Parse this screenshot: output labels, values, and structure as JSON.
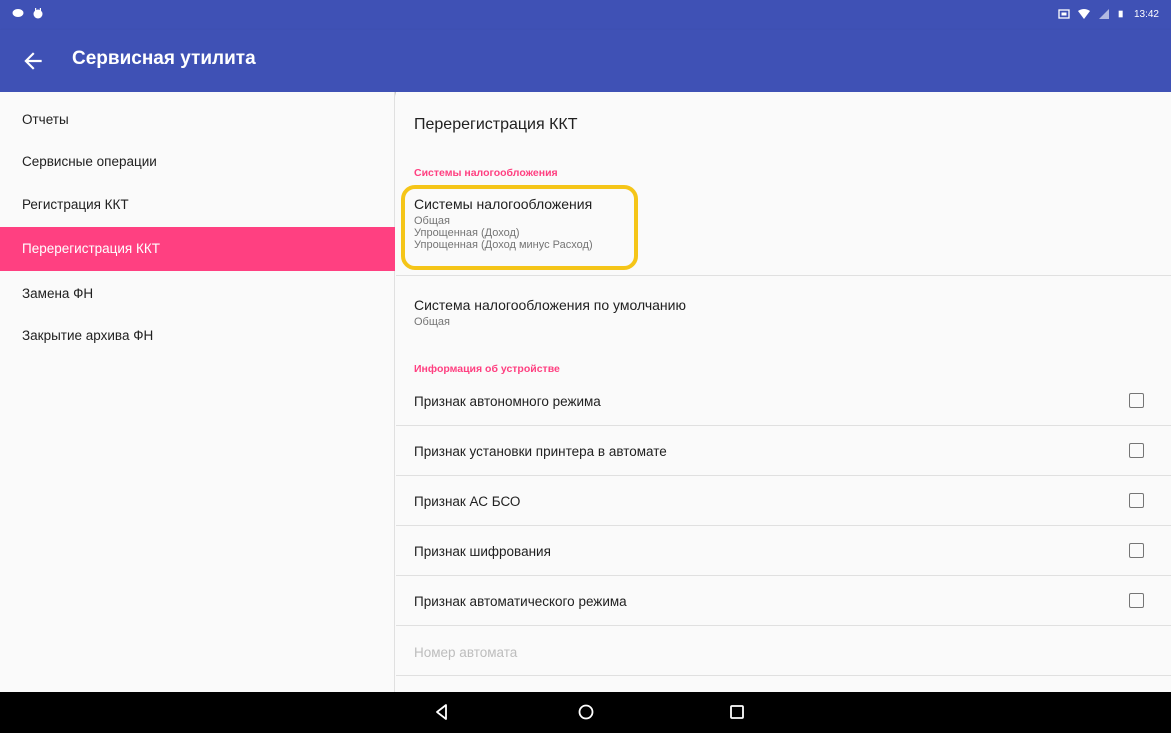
{
  "status_bar": {
    "time": "13:42",
    "icons": [
      "notification-icon",
      "android-icon",
      "nfc-icon",
      "wifi-icon",
      "signal-icon",
      "battery-icon"
    ]
  },
  "app_bar": {
    "title": "Сервисная утилита",
    "back_icon": "arrow-back-icon"
  },
  "sidebar": {
    "items": [
      {
        "label": "Отчеты",
        "active": false
      },
      {
        "label": "Сервисные операции",
        "active": false
      },
      {
        "label": "Регистрация ККТ",
        "active": false
      },
      {
        "label": "Перерегистрация ККТ",
        "active": true
      },
      {
        "label": "Замена ФН",
        "active": false
      },
      {
        "label": "Закрытие архива ФН",
        "active": false
      }
    ]
  },
  "content": {
    "page_title": "Перерегистрация ККТ",
    "section_tax": "Системы налогообложения",
    "tax_systems": {
      "title": "Системы налогообложения",
      "values": [
        "Общая",
        "Упрощенная (Доход)",
        "Упрощенная (Доход минус Расход)"
      ]
    },
    "default_tax": {
      "title": "Система налогообложения по умолчанию",
      "value": "Общая"
    },
    "section_device": "Информация об устройстве",
    "device_flags": [
      {
        "label": "Признак автономного режима",
        "checked": false
      },
      {
        "label": "Признак установки принтера в автомате",
        "checked": false
      },
      {
        "label": "Признак АС БСО",
        "checked": false
      },
      {
        "label": "Признак шифрования",
        "checked": false
      },
      {
        "label": "Признак автоматического режима",
        "checked": false
      }
    ],
    "machine_number_label": "Номер автомата"
  },
  "colors": {
    "primary": "#3f51b5",
    "accent": "#ff4081",
    "highlight": "#f5c518"
  }
}
